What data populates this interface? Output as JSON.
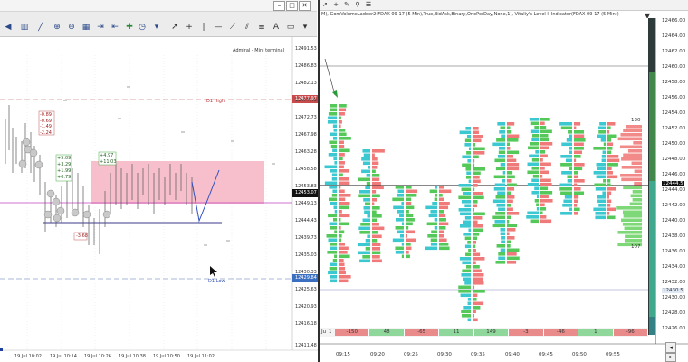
{
  "left_window": {
    "title": "Admiral - Mini terminal",
    "title_visible_text": "Admiral - Mini terminal",
    "price_labels": [
      "12491.53",
      "12486.83",
      "12482.13",
      "12477.43",
      "12472.73",
      "12467.98",
      "12463.28",
      "12458.58",
      "12453.83",
      "12449.13",
      "12444.43",
      "12439.73",
      "12435.03",
      "12430.33",
      "12425.63",
      "12420.93",
      "12416.18",
      "12411.48"
    ],
    "level_high_label": "D1 High",
    "level_high_price": "12477.97",
    "level_low_label": "D1 Low",
    "level_low_price": "12429.84",
    "current_price": "12453.07",
    "time_labels": [
      "19 Jul 10:02",
      "19 Jul 10:14",
      "19 Jul 10:26",
      "19 Jul 10:38",
      "19 Jul 10:50",
      "19 Jul 11:02"
    ],
    "chart_annotations": {
      "red_box_values": [
        "-0.89",
        "-0.69",
        "-1.49",
        "-2.24"
      ],
      "green_box_values": [
        "+5.09",
        "+3.29",
        "+1.99",
        "+0.79"
      ],
      "green_box2_values": [
        "+4.97",
        "+11.03"
      ],
      "red_lower_label": "-3.68"
    }
  },
  "right_window": {
    "header_text": "M), GomVolumeLadder2(FDAX 09-17 (5 Min),True,BidAsk,Binary,OnePerDay,None,1), Vitaliy's Level II Indicator(FDAX 09-17 (5 Min))",
    "price_labels": [
      "12466.00",
      "12464.00",
      "12462.00",
      "12460.00",
      "12458.00",
      "12456.00",
      "12454.00",
      "12452.00",
      "12450.00",
      "12448.00",
      "12446.00",
      "12444.00",
      "12442.00",
      "12440.00",
      "12438.00",
      "12436.00",
      "12434.00",
      "12432.00",
      "12430.00",
      "12428.00",
      "12426.00"
    ],
    "current_price": "12444.5",
    "low_marker_price": "12430.5",
    "time_labels": [
      "09:15",
      "09:20",
      "09:25",
      "09:30",
      "09:35",
      "09:40",
      "09:45",
      "09:50",
      "09:55"
    ],
    "level2_top_label": "130",
    "level2_bottom_label": "107",
    "bottom_row_first": "1",
    "bottom_row_values": [
      {
        "value": "-150",
        "color": "#e98b8b"
      },
      {
        "value": "48",
        "color": "#8fd79b"
      },
      {
        "value": "-65",
        "color": "#e98b8b"
      },
      {
        "value": "11",
        "color": "#8fd79b"
      },
      {
        "value": "149",
        "color": "#8fd79b"
      },
      {
        "value": "-3",
        "color": "#e98b8b"
      },
      {
        "value": "-46",
        "color": "#e98b8b"
      },
      {
        "value": "1",
        "color": "#8fd79b"
      },
      {
        "value": "-96",
        "color": "#e98b8b"
      }
    ],
    "bottom_row_prefix": "Ju"
  },
  "colors": {
    "toolbar_bg": "#ececec",
    "chart_bg": "#ffffff",
    "bid_cyan": "#3cc8d0",
    "ask_red": "#f07a7a",
    "buy_green": "#55c85a",
    "level2_ask": "#f28a8a",
    "level2_bid": "#7fd877",
    "zone_pink": "#f6b4c2",
    "dark_axis": "#2d3b3b"
  }
}
